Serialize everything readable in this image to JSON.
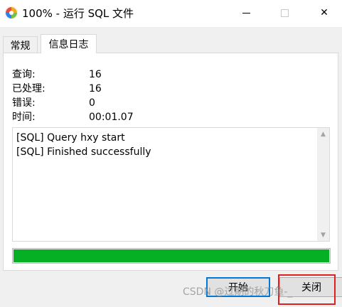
{
  "window": {
    "title": "100% - 运行 SQL 文件",
    "controls": {
      "minimize": "minimize",
      "maximize": "maximize",
      "close": "✕"
    }
  },
  "tabs": [
    {
      "label": "常规",
      "active": false
    },
    {
      "label": "信息日志",
      "active": true
    }
  ],
  "stats": [
    {
      "label": "查询:",
      "value": "16"
    },
    {
      "label": "已处理:",
      "value": "16"
    },
    {
      "label": "错误:",
      "value": "0"
    },
    {
      "label": "时间:",
      "value": "00:01.07"
    }
  ],
  "log": {
    "lines": [
      "[SQL] Query hxy start",
      "[SQL] Finished successfully"
    ]
  },
  "progress": {
    "percent": 100,
    "color": "#06b025"
  },
  "buttons": {
    "start": "开始",
    "close": "关闭"
  },
  "watermark": "CSDN @过期的秋刀鱼-_",
  "colors": {
    "accent": "#0078d7",
    "highlight": "#e02020"
  }
}
